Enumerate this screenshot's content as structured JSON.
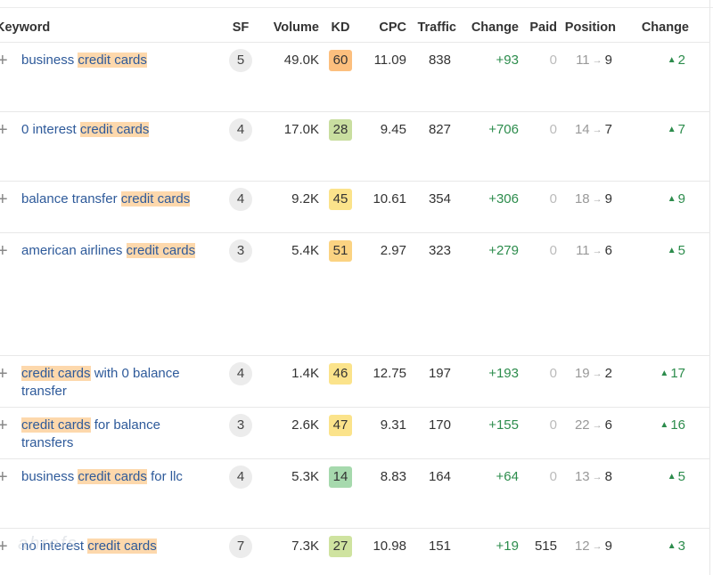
{
  "columns": {
    "keyword": "Keyword",
    "sf": "SF",
    "volume": "Volume",
    "kd": "KD",
    "cpc": "CPC",
    "traffic": "Traffic",
    "change": "Change",
    "paid": "Paid",
    "position": "Position",
    "pos_change": "Change"
  },
  "highlight_term": "credit cards",
  "icons": {
    "expand": "+",
    "arrow": "→",
    "up": "▲"
  },
  "colors": {
    "kd_60": "#fcbf7e",
    "kd_28": "#c9dea0",
    "kd_45": "#fbe38b",
    "kd_51": "#fbd382",
    "kd_46": "#fbe38b",
    "kd_47": "#fbe38b",
    "kd_14": "#a6d9ad",
    "kd_27": "#cfe3a0",
    "positive": "#2c8c4c",
    "link": "#2e5a9a",
    "highlight": "#fdd8ac"
  },
  "rows": [
    {
      "pre": "business ",
      "hl": "credit cards",
      "post": "",
      "sf": "5",
      "volume": "49.0K",
      "kd": "60",
      "kd_color": "#fcbf7e",
      "cpc": "11.09",
      "traffic": "838",
      "change": "+93",
      "paid": "0",
      "pos_from": "11",
      "pos_to": "9",
      "pos_change": "2"
    },
    {
      "pre": "0 interest ",
      "hl": "credit cards",
      "post": "",
      "sf": "4",
      "volume": "17.0K",
      "kd": "28",
      "kd_color": "#c9dea0",
      "cpc": "9.45",
      "traffic": "827",
      "change": "+706",
      "paid": "0",
      "pos_from": "14",
      "pos_to": "7",
      "pos_change": "7"
    },
    {
      "pre": "balance transfer ",
      "hl": "credit cards",
      "post": "",
      "sf": "4",
      "volume": "9.2K",
      "kd": "45",
      "kd_color": "#fbe38b",
      "cpc": "10.61",
      "traffic": "354",
      "change": "+306",
      "paid": "0",
      "pos_from": "18",
      "pos_to": "9",
      "pos_change": "9"
    },
    {
      "pre": "american airlines ",
      "hl": "credit cards",
      "post": "",
      "sf": "3",
      "volume": "5.4K",
      "kd": "51",
      "kd_color": "#fbd382",
      "cpc": "2.97",
      "traffic": "323",
      "change": "+279",
      "paid": "0",
      "pos_from": "11",
      "pos_to": "6",
      "pos_change": "5"
    },
    {
      "pre": "",
      "hl": "credit cards",
      "post": " with 0 balance transfer",
      "sf": "4",
      "volume": "1.4K",
      "kd": "46",
      "kd_color": "#fbe38b",
      "cpc": "12.75",
      "traffic": "197",
      "change": "+193",
      "paid": "0",
      "pos_from": "19",
      "pos_to": "2",
      "pos_change": "17"
    },
    {
      "pre": "",
      "hl": "credit cards",
      "post": " for balance transfers",
      "sf": "3",
      "volume": "2.6K",
      "kd": "47",
      "kd_color": "#fbe38b",
      "cpc": "9.31",
      "traffic": "170",
      "change": "+155",
      "paid": "0",
      "pos_from": "22",
      "pos_to": "6",
      "pos_change": "16"
    },
    {
      "pre": "business ",
      "hl": "credit cards",
      "post": " for llc",
      "sf": "4",
      "volume": "5.3K",
      "kd": "14",
      "kd_color": "#a6d9ad",
      "cpc": "8.83",
      "traffic": "164",
      "change": "+64",
      "paid": "0",
      "pos_from": "13",
      "pos_to": "8",
      "pos_change": "5"
    },
    {
      "pre": "no interest ",
      "hl": "credit cards",
      "post": "",
      "sf": "7",
      "volume": "7.3K",
      "kd": "27",
      "kd_color": "#cfe3a0",
      "cpc": "10.98",
      "traffic": "151",
      "change": "+19",
      "paid": "515",
      "pos_from": "12",
      "pos_to": "9",
      "pos_change": "3"
    }
  ],
  "watermark": "ahrefs"
}
